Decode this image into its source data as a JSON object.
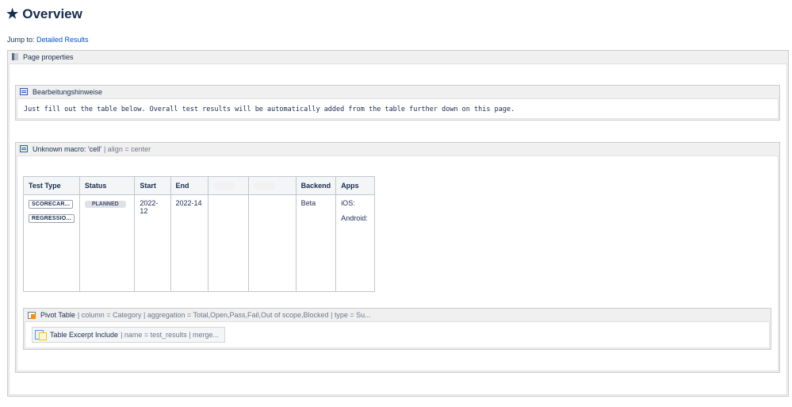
{
  "page": {
    "title": "Overview",
    "title_icon": "star-icon",
    "jump_prefix": "Jump to: ",
    "jump_link": "Detailed Results"
  },
  "page_properties": {
    "label": "Page properties"
  },
  "hints_macro": {
    "label": "Bearbeitungshinweise",
    "text": "Just fill out the table below. Overall test results will be automatically added from the table further down on this page."
  },
  "cell_macro": {
    "label": "Unknown macro: 'cell'",
    "params": "| align = center"
  },
  "table": {
    "headers": [
      "Test Type",
      "Status",
      "Start",
      "End",
      "",
      "",
      "Backend",
      "Apps"
    ],
    "test_types": [
      "SCORECAR...",
      "REGRESSIO..."
    ],
    "status": "PLANNED",
    "start": "2022-12",
    "end": "2022-14",
    "backend": "Beta",
    "apps": [
      "iOS:",
      "Android:"
    ]
  },
  "pivot_macro": {
    "label": "Pivot Table",
    "params": "| column = Category | aggregation = Total,Open,Pass,Fail,Out of scope,Blocked | type = Su..."
  },
  "excerpt_macro": {
    "label": "Table Excerpt Include",
    "params": "| name = test_results | merge..."
  },
  "colors": {
    "link": "#0052cc",
    "text": "#172b4d",
    "macro_bg": "#f0f0f0",
    "status_bg": "#dfe1e6"
  }
}
